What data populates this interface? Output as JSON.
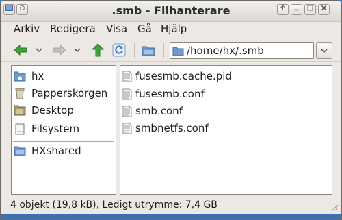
{
  "window": {
    "title": ".smb - Filhanterare"
  },
  "menubar": {
    "items": [
      "Arkiv",
      "Redigera",
      "Visa",
      "Gå",
      "Hjälp"
    ]
  },
  "location": {
    "path": "/home/hx/.smb"
  },
  "sidebar": {
    "places": [
      {
        "label": "hx",
        "icon": "home-folder-icon"
      },
      {
        "label": "Papperskorgen",
        "icon": "trash-icon"
      },
      {
        "label": "Desktop",
        "icon": "desktop-icon"
      },
      {
        "label": "Filsystem",
        "icon": "drive-icon"
      }
    ],
    "bookmarks": [
      {
        "label": "HXshared",
        "icon": "folder-icon"
      }
    ]
  },
  "files": [
    {
      "name": "fusesmb.cache.pid",
      "icon": "text-file-icon"
    },
    {
      "name": "fusesmb.conf",
      "icon": "text-file-icon"
    },
    {
      "name": "smb.conf",
      "icon": "text-file-icon"
    },
    {
      "name": "smbnetfs.conf",
      "icon": "text-file-icon"
    }
  ],
  "status": {
    "text": "4 objekt (19,8 kB), Ledigt utrymme: 7,4 GB"
  },
  "colors": {
    "desktop_bg": "#4a7fc4",
    "window_bg": "#ece9e4",
    "arrow_green": "#3fa43a",
    "folder_blue": "#6f9bd1"
  }
}
